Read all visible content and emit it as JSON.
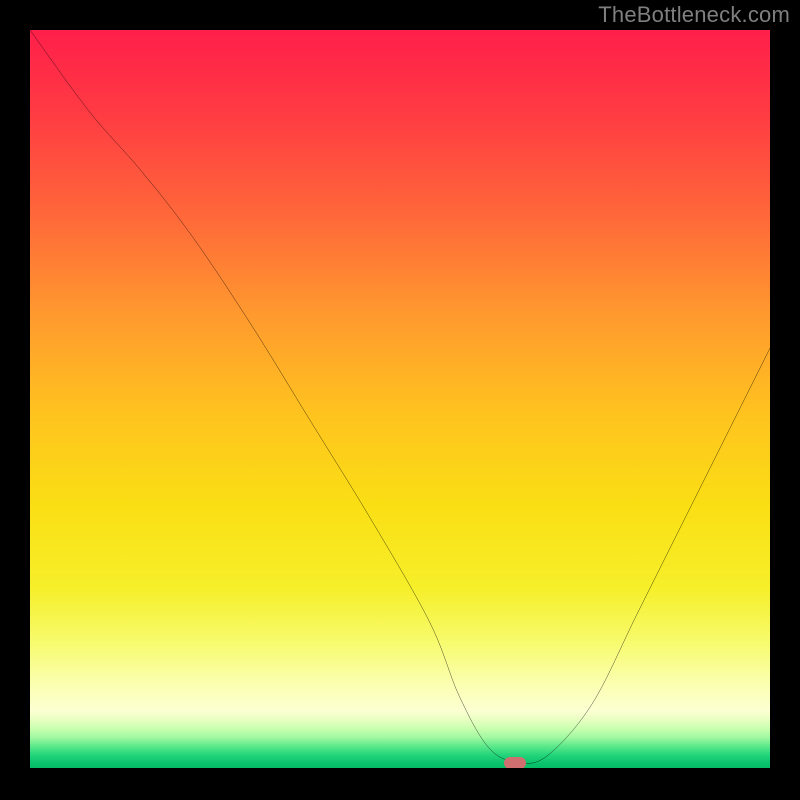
{
  "watermark": "TheBottleneck.com",
  "chart_data": {
    "type": "line",
    "title": "",
    "xlabel": "",
    "ylabel": "",
    "xlim": [
      0,
      100
    ],
    "ylim": [
      0,
      100
    ],
    "grid": false,
    "legend": false,
    "background": "red-yellow-green vertical gradient (red top, green bottom)",
    "series": [
      {
        "name": "bottleneck-curve",
        "x": [
          0,
          8,
          15,
          22,
          30,
          38,
          46,
          54,
          58,
          62,
          66,
          70,
          76,
          82,
          88,
          94,
          100
        ],
        "values": [
          100,
          89,
          81,
          72,
          60,
          47,
          34,
          20,
          10,
          3,
          1,
          2,
          9,
          21,
          33,
          45,
          57
        ]
      }
    ],
    "min_point": {
      "x": 65,
      "y": 1
    },
    "marker": {
      "x": 65.5,
      "y": 1,
      "color": "#cf6f6f"
    },
    "colors": {
      "curve": "#000000",
      "top": "#ff1f4a",
      "mid": "#fadf14",
      "bottom": "#04b963",
      "frame": "#000000",
      "watermark": "#7f7f7f"
    }
  }
}
